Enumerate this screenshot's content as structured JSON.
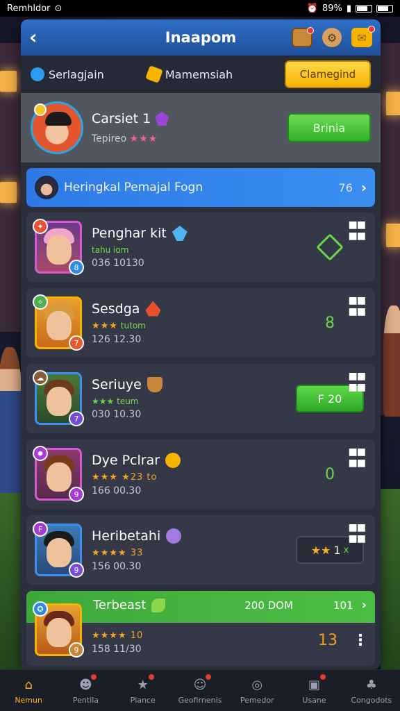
{
  "status_bar": {
    "left_text": "Remhldor",
    "battery_pct": "89%"
  },
  "header": {
    "title": "Inaapom"
  },
  "tabs": {
    "tab1": "Serlagjain",
    "tab2": "Mamemsiah",
    "button": "Clamegind"
  },
  "profile": {
    "name": "Carsiet 1",
    "sub": "Tepireo",
    "stars": "★★★",
    "button": "Brinia"
  },
  "banner": {
    "text": "Heringkal Pemajal Fogn",
    "count": "76"
  },
  "cards": [
    {
      "name": "Penghar kit",
      "rating_text": "tahu iom",
      "meta": "036 10130",
      "right": ""
    },
    {
      "name": "Sesdga",
      "rating_text": "tutom",
      "meta": "126 12.30",
      "right": "8"
    },
    {
      "name": "Seriuye",
      "rating_text": "teum",
      "meta": "030 10.30",
      "right": "F 20"
    },
    {
      "name": "Dye Pclrar",
      "rating_text": "★★★ ★23 to",
      "meta": "166 00.30",
      "right": "0"
    },
    {
      "name": "Heribetahi",
      "rating_text": "★★★★ 33",
      "meta": "156 00.30",
      "right_stars": "★★",
      "right_num": "1",
      "right_x": "x"
    }
  ],
  "featured": {
    "name": "Terbeast",
    "mid": "200 DOM",
    "num": "101",
    "rating": "★★★★ 10",
    "meta": "158 11/30",
    "value": "13"
  },
  "bottom_nav": [
    {
      "label": "Nemun",
      "icon": "home-icon"
    },
    {
      "label": "Pentila",
      "icon": "profile-icon"
    },
    {
      "label": "Plance",
      "icon": "star-icon"
    },
    {
      "label": "Geofirnenis",
      "icon": "chat-icon"
    },
    {
      "label": "Pemedor",
      "icon": "search-icon"
    },
    {
      "label": "Usane",
      "icon": "user-icon"
    },
    {
      "label": "Congodots",
      "icon": "group-icon"
    }
  ],
  "colors": {
    "header": "#2f6fc6",
    "accent_yellow": "#f6b400",
    "accent_green": "#33b02a",
    "banner_blue": "#2f7ae6",
    "card_bg": "#353947"
  }
}
